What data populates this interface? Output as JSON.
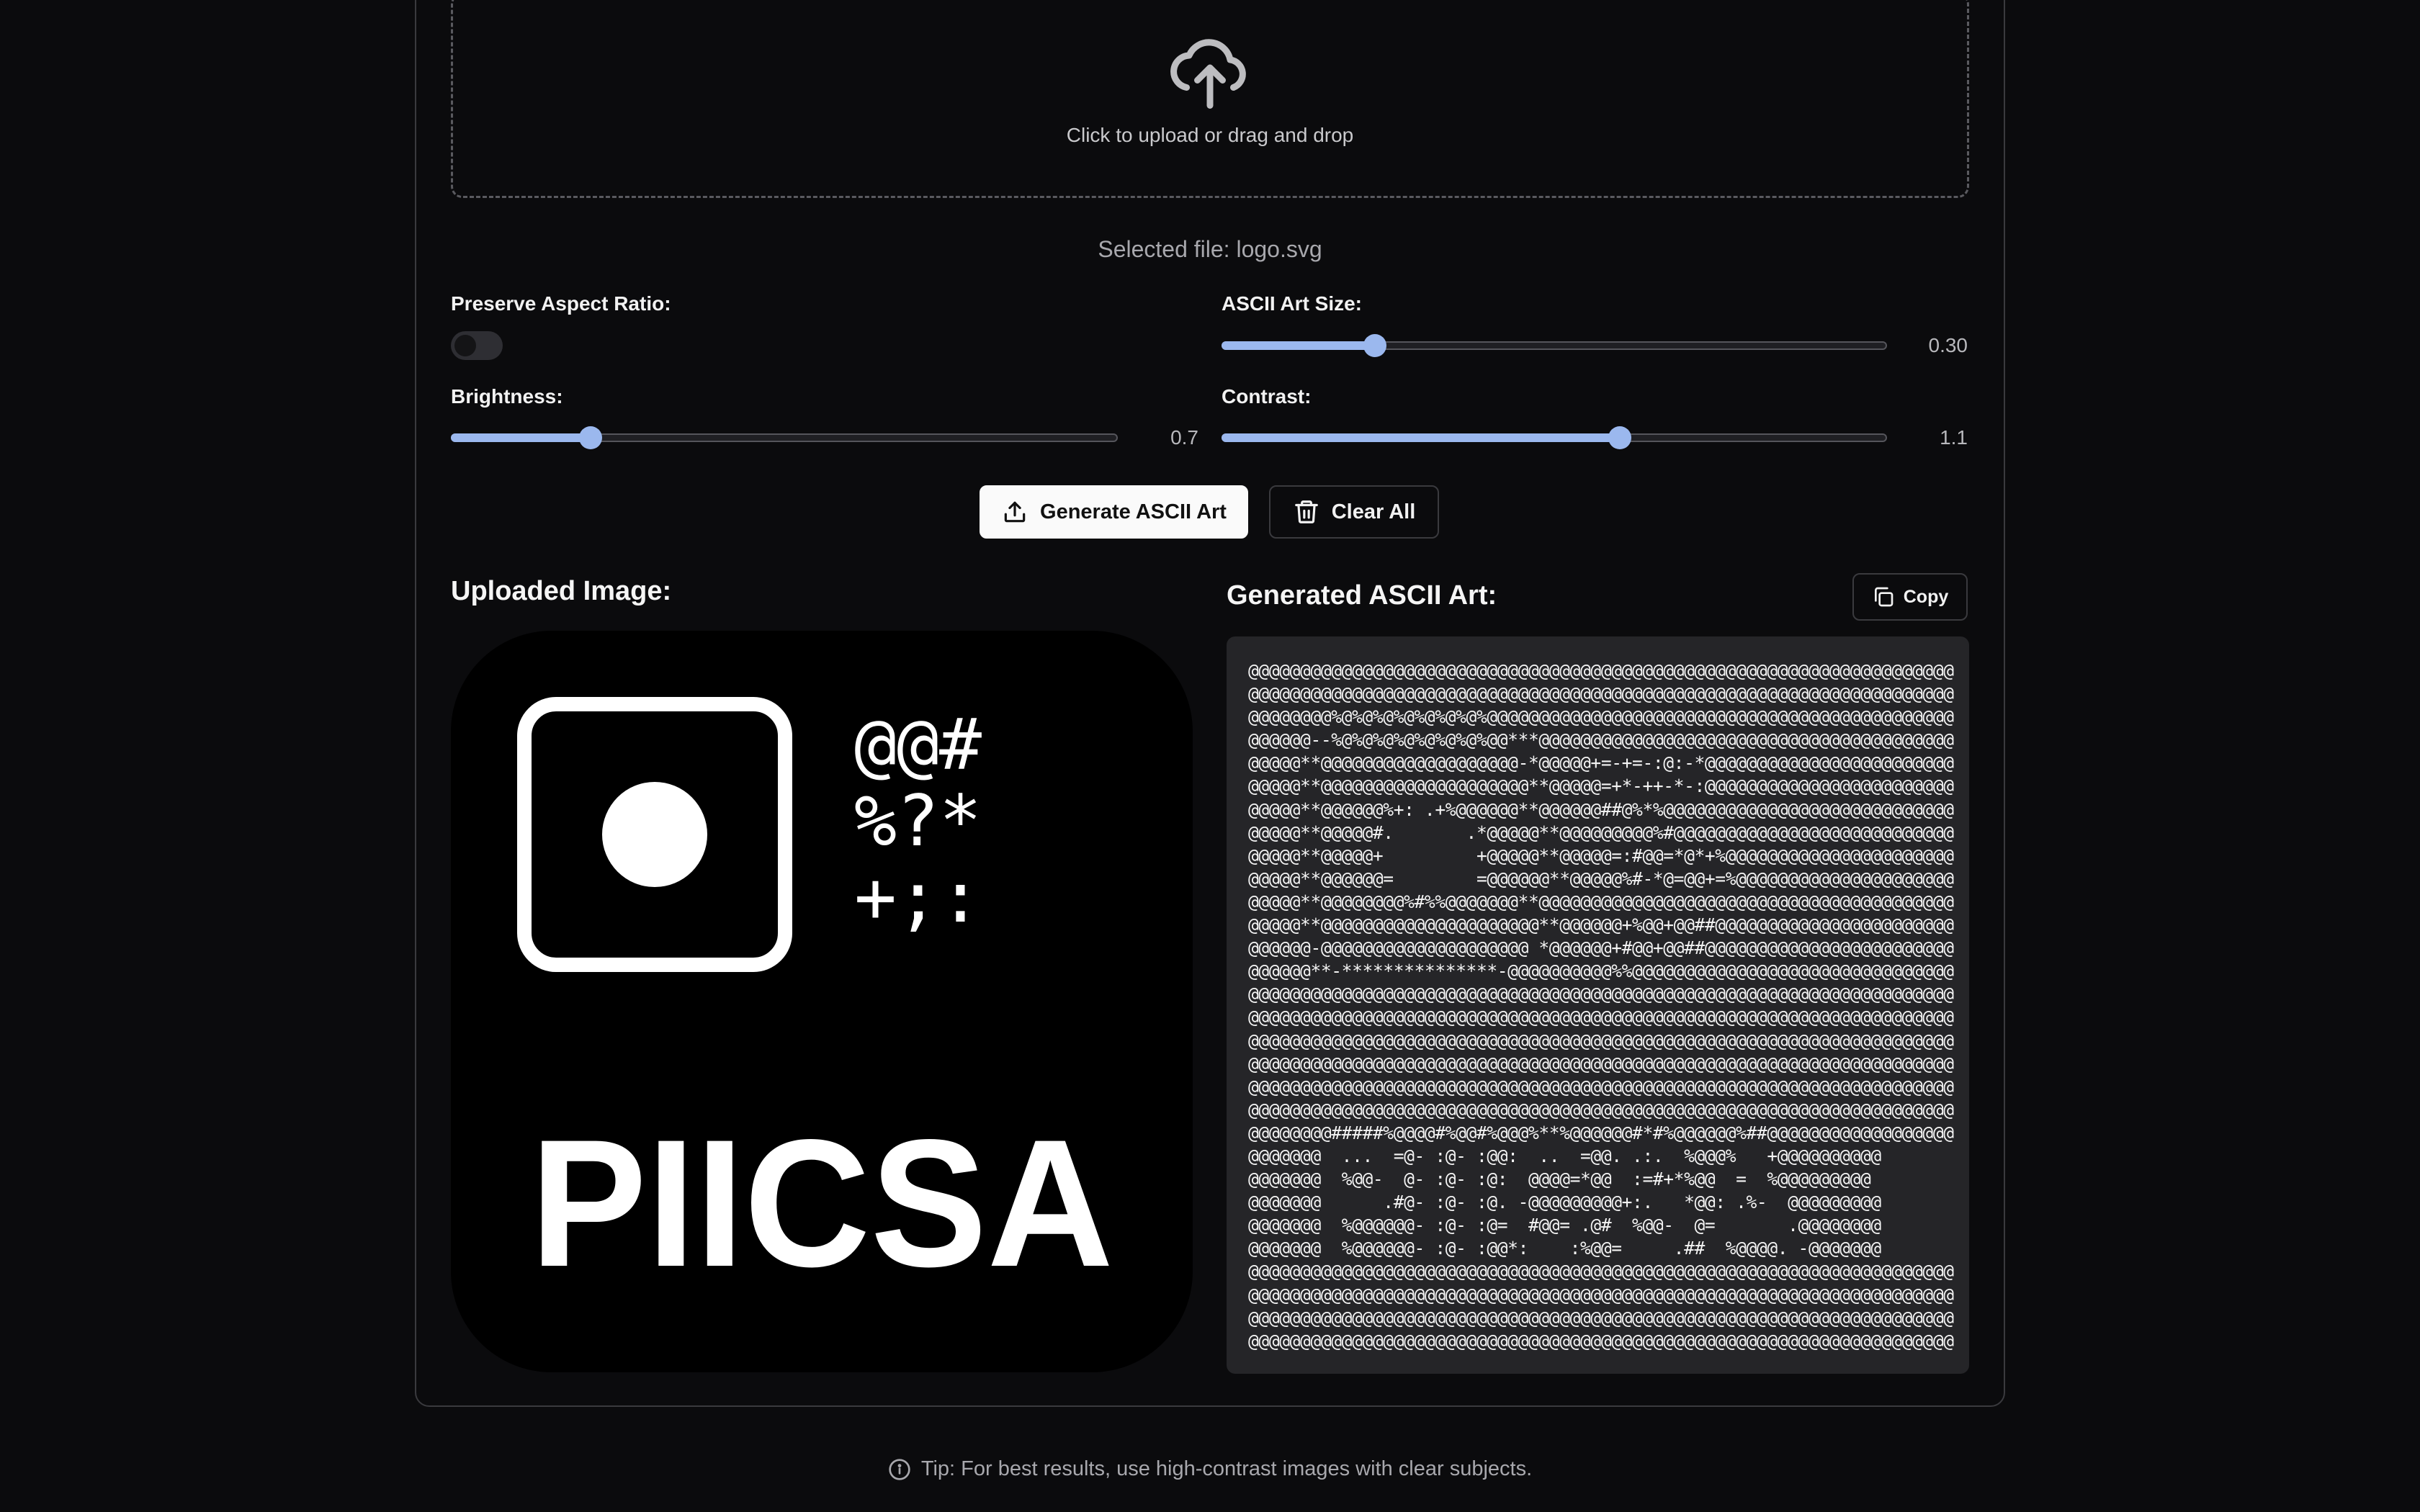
{
  "upload": {
    "prompt": "Click to upload or drag and drop",
    "selected_file": "Selected file: logo.svg"
  },
  "controls": {
    "aspect": {
      "label": "Preserve Aspect Ratio:",
      "enabled": false
    },
    "size": {
      "label": "ASCII Art Size:",
      "value": "0.30",
      "level": 0.23
    },
    "brightness": {
      "label": "Brightness:",
      "value": "0.7",
      "level": 0.21
    },
    "contrast": {
      "label": "Contrast:",
      "value": "1.1",
      "level": 0.598
    }
  },
  "actions": {
    "generate": "Generate ASCII Art",
    "clear": "Clear All"
  },
  "uploaded": {
    "title": "Uploaded Image:",
    "logo_glyphs": [
      "@@#",
      "%?*",
      "+;:"
    ],
    "logo_word": "PIICSA"
  },
  "generated": {
    "title": "Generated ASCII Art:",
    "copy": "Copy",
    "ascii": "@@@@@@@@@@@@@@@@@@@@@@@@@@@@@@@@@@@@@@@@@@@@@@@@@@@@@@@@@@@@@@@@@@@@\n@@@@@@@@@@@@@@@@@@@@@@@@@@@@@@@@@@@@@@@@@@@@@@@@@@@@@@@@@@@@@@@@@@@@\n@@@@@@@@%@%@%@%@%@%@%@%@@@@@@@@@@@@@@@@@@@@@@@@@@@@@@@@@@@@@@@@@@@@@\n@@@@@@--%@%@%@%@%@%@%@%@@***@@@@@@@@@@@@@@@@@@@@@@@@@@@@@@@@@@@@@@@@\n@@@@@**@@@@@@@@@@@@@@@@@@@-*@@@@@+=-+=-:@:-*@@@@@@@@@@@@@@@@@@@@@@@@\n@@@@@**@@@@@@@@@@@@@@@@@@@@**@@@@@=+*-++-*-:@@@@@@@@@@@@@@@@@@@@@@@@\n@@@@@**@@@@@@%+: .+%@@@@@@**@@@@@@##@%*%@@@@@@@@@@@@@@@@@@@@@@@@@@@@\n@@@@@**@@@@@#.       .*@@@@@**@@@@@@@@@%#@@@@@@@@@@@@@@@@@@@@@@@@@@@\n@@@@@**@@@@@+         +@@@@@**@@@@@=:#@@=*@*+%@@@@@@@@@@@@@@@@@@@@@@\n@@@@@**@@@@@@=        =@@@@@@**@@@@@%#-*@=@@+=%@@@@@@@@@@@@@@@@@@@@@\n@@@@@**@@@@@@@@%#%%@@@@@@@**@@@@@@@@@@@@@@@@@@@@@@@@@@@@@@@@@@@@@@@@\n@@@@@**@@@@@@@@@@@@@@@@@@@@@**@@@@@@+%@@+@@##@@@@@@@@@@@@@@@@@@@@@@@\n@@@@@@-@@@@@@@@@@@@@@@@@@@@ *@@@@@@+#@@+@@##@@@@@@@@@@@@@@@@@@@@@@@@\n@@@@@@**-***************-@@@@@@@@@@%%@@@@@@@@@@@@@@@@@@@@@@@@@@@@@@@\n@@@@@@@@@@@@@@@@@@@@@@@@@@@@@@@@@@@@@@@@@@@@@@@@@@@@@@@@@@@@@@@@@@@@\n@@@@@@@@@@@@@@@@@@@@@@@@@@@@@@@@@@@@@@@@@@@@@@@@@@@@@@@@@@@@@@@@@@@@\n@@@@@@@@@@@@@@@@@@@@@@@@@@@@@@@@@@@@@@@@@@@@@@@@@@@@@@@@@@@@@@@@@@@@\n@@@@@@@@@@@@@@@@@@@@@@@@@@@@@@@@@@@@@@@@@@@@@@@@@@@@@@@@@@@@@@@@@@@@\n@@@@@@@@@@@@@@@@@@@@@@@@@@@@@@@@@@@@@@@@@@@@@@@@@@@@@@@@@@@@@@@@@@@@\n@@@@@@@@@@@@@@@@@@@@@@@@@@@@@@@@@@@@@@@@@@@@@@@@@@@@@@@@@@@@@@@@@@@@\n@@@@@@@@#####%@@@@#%@@#%@@@%**%@@@@@@#*#%@@@@@@%##@@@@@@@@@@@@@@@@@@\n@@@@@@@  ...  =@- :@- :@@:  ..  =@@. .:.  %@@@%   +@@@@@@@@@@\n@@@@@@@  %@@-  @- :@- :@:  @@@@=*@@  :=#+*%@@  =  %@@@@@@@@@\n@@@@@@@      .#@- :@- :@. -@@@@@@@@@+:.   *@@: .%-  @@@@@@@@@\n@@@@@@@  %@@@@@@- :@- :@=  #@@= .@#  %@@-  @=       .@@@@@@@@\n@@@@@@@  %@@@@@@- :@- :@@*:    :%@@=     .##  %@@@@. -@@@@@@@\n@@@@@@@@@@@@@@@@@@@@@@@@@@@@@@@@@@@@@@@@@@@@@@@@@@@@@@@@@@@@@@@@@@@@\n@@@@@@@@@@@@@@@@@@@@@@@@@@@@@@@@@@@@@@@@@@@@@@@@@@@@@@@@@@@@@@@@@@@@\n@@@@@@@@@@@@@@@@@@@@@@@@@@@@@@@@@@@@@@@@@@@@@@@@@@@@@@@@@@@@@@@@@@@@\n@@@@@@@@@@@@@@@@@@@@@@@@@@@@@@@@@@@@@@@@@@@@@@@@@@@@@@@@@@@@@@@@@@@@"
  },
  "tip": "Tip: For best results, use high-contrast images with clear subjects.",
  "icons": {
    "upload_zone": "cloud-upload-icon",
    "generate": "upload-arrow-icon",
    "clear": "trash-icon",
    "copy": "copy-icon",
    "tip": "info-icon"
  },
  "colors": {
    "accent": "#9bb8ee",
    "background": "#0b0b0d",
    "ascii_panel": "#252528"
  }
}
